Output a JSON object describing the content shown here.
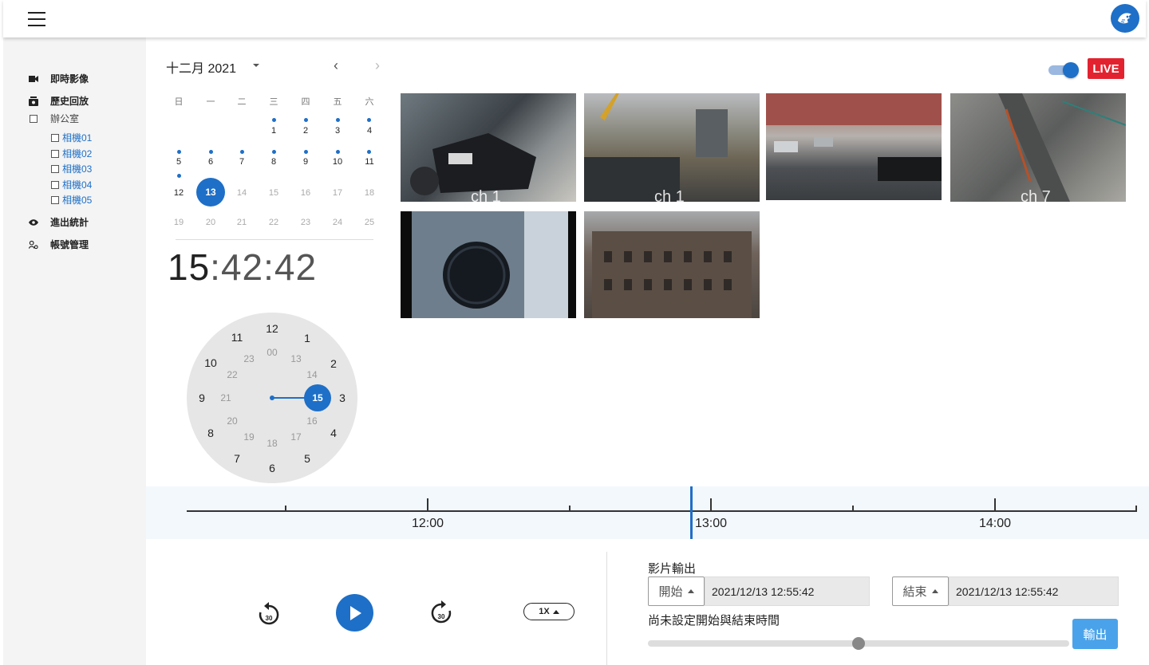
{
  "header": {
    "menu_icon": "hamburger-icon",
    "logo_icon": "tiger-logo-icon"
  },
  "sidebar": {
    "live": "即時影像",
    "history": "歷史回放",
    "office": "辦公室",
    "cameras": [
      "相機01",
      "相機02",
      "相機03",
      "相機04",
      "相機05"
    ],
    "stats": "進出統計",
    "accounts": "帳號管理"
  },
  "calendar": {
    "month_label": "十二月 2021",
    "weekdays": [
      "日",
      "一",
      "二",
      "三",
      "四",
      "五",
      "六"
    ],
    "rows": [
      [
        "",
        "",
        "",
        "1",
        "2",
        "3",
        "4"
      ],
      [
        "5",
        "6",
        "7",
        "8",
        "9",
        "10",
        "11"
      ],
      [
        "12",
        "13",
        "14",
        "15",
        "16",
        "17",
        "18"
      ],
      [
        "19",
        "20",
        "21",
        "22",
        "23",
        "24",
        "25"
      ]
    ],
    "selected": "13"
  },
  "clock": {
    "hour": "15",
    "sep1": ":",
    "minute": "42",
    "sep2": ":",
    "second": "42",
    "outer": [
      "12",
      "1",
      "2",
      "3",
      "4",
      "5",
      "6",
      "7",
      "8",
      "9",
      "10",
      "11"
    ],
    "inner": [
      "00",
      "13",
      "14",
      "15",
      "16",
      "17",
      "18",
      "19",
      "20",
      "21",
      "22",
      "23"
    ]
  },
  "live_badge": "LIVE",
  "thumbnails": [
    {
      "label": "ch 1"
    },
    {
      "label": "ch 1"
    },
    {
      "label": ""
    },
    {
      "label": "ch 7"
    },
    {
      "label": ""
    },
    {
      "label": ""
    }
  ],
  "timeline": {
    "ticks": [
      "12:00",
      "13:00",
      "14:00"
    ]
  },
  "player": {
    "rewind_label": "30",
    "forward_label": "30",
    "speed": "1X"
  },
  "export": {
    "title": "影片輸出",
    "start_label": "開始",
    "start_value": "2021/12/13 12:55:42",
    "end_label": "結束",
    "end_value": "2021/12/13 12:55:42",
    "status": "尚未設定開始與結束時間",
    "button": "輸出",
    "slider_value": 0.5
  }
}
